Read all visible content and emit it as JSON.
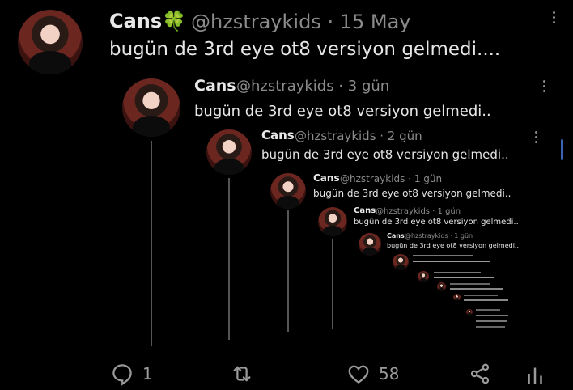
{
  "tweet": {
    "name": "Cans",
    "emoji": "🍀",
    "handle": "@hzstraykids",
    "time": "15 May",
    "text": "bugün de 3rd eye ot8 versiyon gelmedi...."
  },
  "nested": [
    {
      "name": "Cans",
      "handle": "@hzstraykids · 3 gün",
      "text": "bugün de 3rd eye ot8 versiyon gelmedi.."
    },
    {
      "name": "Cans",
      "handle": "@hzstraykids · 2 gün",
      "text": "bugün de 3rd eye ot8 versiyon gelmedi.."
    },
    {
      "name": "Cans",
      "handle": "@hzstraykids · 1 gün",
      "text": "bugün de 3rd eye ot8 versiyon gelmedi.."
    },
    {
      "name": "Cans",
      "handle": "@hzstraykids · 1 gün",
      "text": "bugün de 3rd eye ot8 versiyon gelmedi.."
    },
    {
      "name": "Cans",
      "handle": "@hzstraykids · 1 gün",
      "text": "bugün de 3rd eye ot8 versiyon gelmedi.."
    }
  ],
  "actions": {
    "reply_count": "1",
    "retweet_count": "",
    "like_count": "58"
  },
  "icons": [
    "reply-icon",
    "retweet-icon",
    "like-icon",
    "share-icon",
    "analytics-icon",
    "more-icon"
  ]
}
